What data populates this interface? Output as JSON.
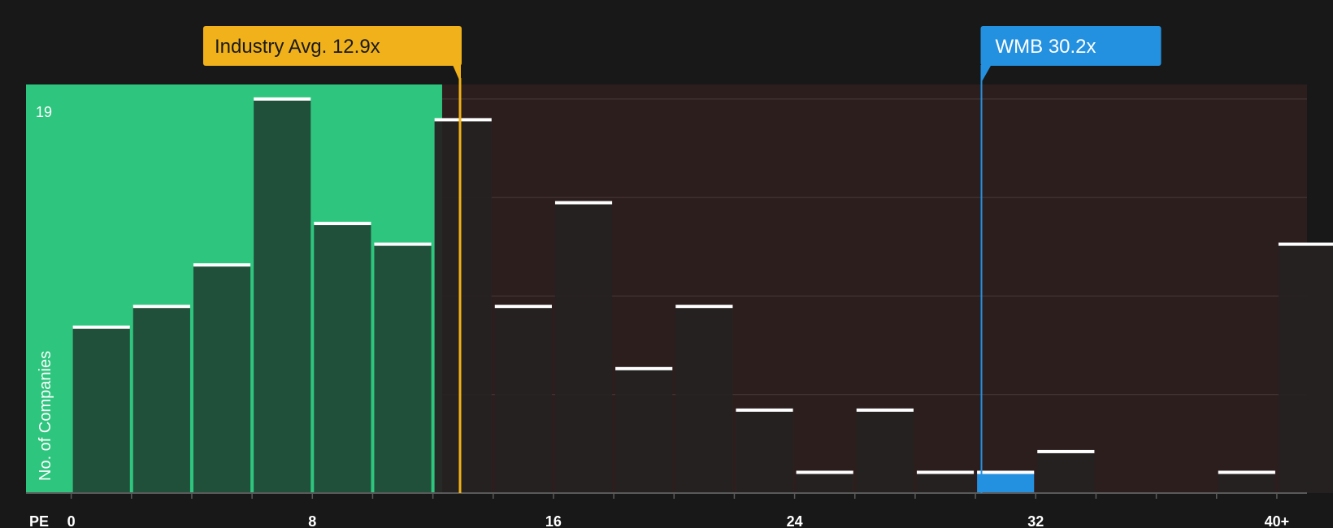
{
  "chart_data": {
    "type": "bar",
    "x_axis_label": "PE",
    "y_axis_label": "No. of Companies",
    "y_max_label": "19",
    "x_tick_labels": [
      {
        "value": 0,
        "label": "0"
      },
      {
        "value": 8,
        "label": "8"
      },
      {
        "value": 16,
        "label": "16"
      },
      {
        "value": 24,
        "label": "24"
      },
      {
        "value": 32,
        "label": "32"
      },
      {
        "value": 40,
        "label": "40+"
      }
    ],
    "bin_width": 2,
    "x_range": [
      -1.5,
      41.0
    ],
    "y_range": [
      0,
      19.7
    ],
    "bins": [
      {
        "start": 0,
        "count": 8
      },
      {
        "start": 2,
        "count": 9
      },
      {
        "start": 4,
        "count": 11
      },
      {
        "start": 6,
        "count": 19
      },
      {
        "start": 8,
        "count": 13
      },
      {
        "start": 10,
        "count": 12
      },
      {
        "start": 12,
        "count": 18
      },
      {
        "start": 14,
        "count": 9
      },
      {
        "start": 16,
        "count": 14
      },
      {
        "start": 18,
        "count": 6
      },
      {
        "start": 20,
        "count": 9
      },
      {
        "start": 22,
        "count": 4
      },
      {
        "start": 24,
        "count": 1
      },
      {
        "start": 26,
        "count": 4
      },
      {
        "start": 28,
        "count": 1
      },
      {
        "start": 30,
        "count": 1,
        "highlight": true
      },
      {
        "start": 32,
        "count": 2
      },
      {
        "start": 34,
        "count": 0
      },
      {
        "start": 36,
        "count": 0
      },
      {
        "start": 38,
        "count": 1
      },
      {
        "start": 40,
        "count": 12
      }
    ],
    "industry_avg": {
      "value": 12.9,
      "label": "Industry Avg. 12.9x"
    },
    "company": {
      "value": 30.2,
      "label": "WMB 30.2x"
    },
    "colors": {
      "background": "#181818",
      "green_zone": "#2ec67e",
      "red_zone": "#2d1e1e",
      "bar_green": "#214a37",
      "bar_dark": "#262222",
      "bar_cap": "#ffffff",
      "industry_marker": "#f0b11a",
      "company_marker": "#2491e0",
      "axis": "#5a5a5a",
      "grid": "#4a3a3a",
      "text": "#ffffff",
      "label_dark_text": "#1a1a1a"
    }
  }
}
